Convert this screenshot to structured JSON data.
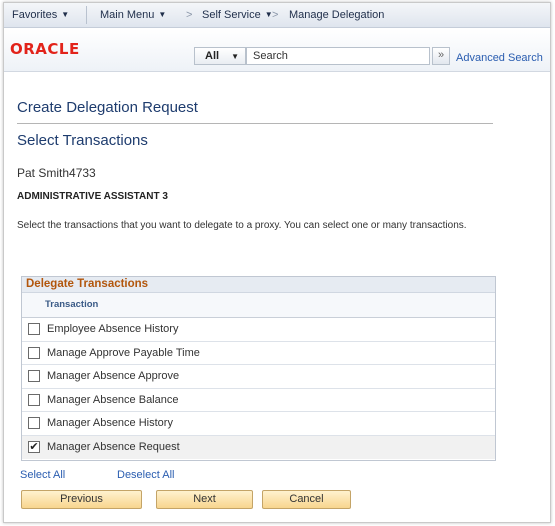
{
  "topnav": {
    "favorites": "Favorites",
    "main_menu": "Main Menu",
    "self_service": "Self Service",
    "manage_delegation": "Manage Delegation",
    "crumb_sep": ">"
  },
  "header": {
    "logo": "ORACLE",
    "search_category": "All",
    "search_placeholder": "Search",
    "go_glyph": "»",
    "advanced_search": "Advanced Search"
  },
  "page": {
    "title": "Create Delegation Request",
    "subtitle": "Select Transactions",
    "employee_name": "Pat Smith4733",
    "job_title": "ADMINISTRATIVE ASSISTANT 3",
    "instructions": "Select the transactions that you want to delegate to a proxy. You can select one or many transactions."
  },
  "grid": {
    "title": "Delegate Transactions",
    "column_header": "Transaction",
    "rows": [
      {
        "label": "Employee Absence History",
        "checked": false
      },
      {
        "label": "Manage Approve Payable Time",
        "checked": false
      },
      {
        "label": "Manager Absence Approve",
        "checked": false
      },
      {
        "label": "Manager Absence Balance",
        "checked": false
      },
      {
        "label": "Manager Absence History",
        "checked": false
      },
      {
        "label": "Manager Absence Request",
        "checked": true
      }
    ]
  },
  "links": {
    "select_all": "Select All",
    "deselect_all": "Deselect All"
  },
  "buttons": {
    "previous": "Previous",
    "next": "Next",
    "cancel": "Cancel"
  },
  "colors": {
    "oracle_red": "#e2231a",
    "title_blue": "#1e3c6e",
    "grid_title_orange": "#b2560c",
    "link_blue": "#2a5db0",
    "button_gold": "#f8d58e"
  }
}
